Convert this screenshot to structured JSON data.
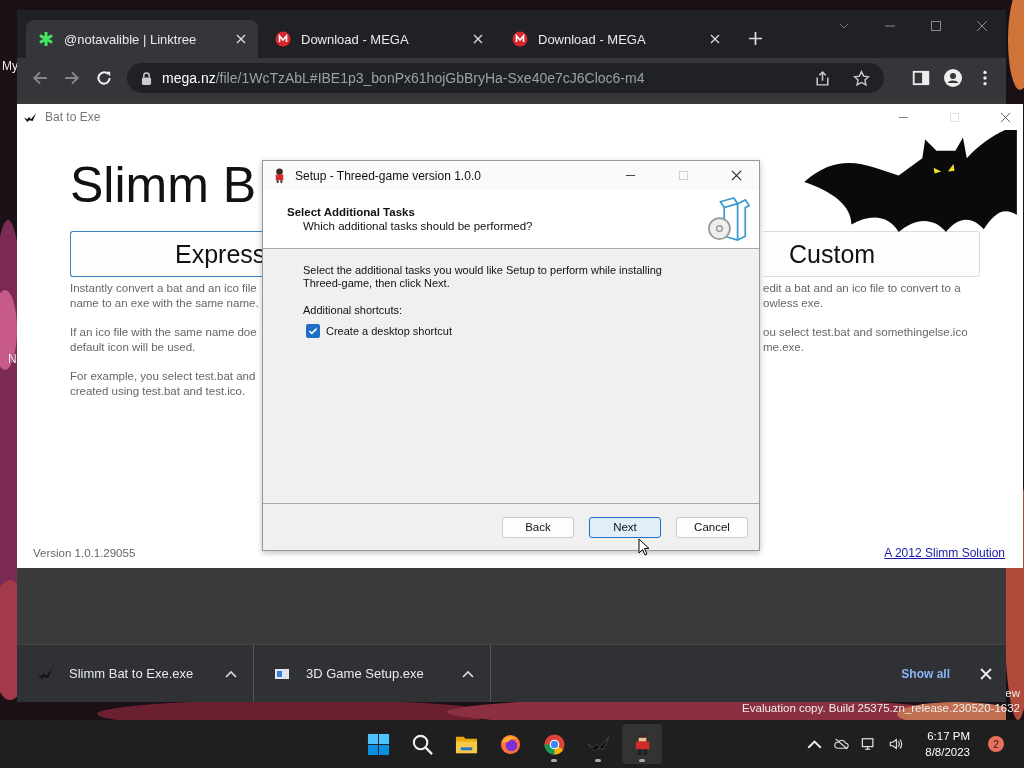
{
  "desktop": {
    "labels": [
      "My",
      "N"
    ],
    "watermark": [
      "ew",
      "Evaluation copy. Build 25375.zn_release.230520-1632"
    ]
  },
  "browser": {
    "tabs": [
      {
        "title": "@notavalible | Linktree",
        "kind": "linktree",
        "selected": true
      },
      {
        "title": "Download - MEGA",
        "kind": "mega",
        "selected": false
      },
      {
        "title": "Download - MEGA",
        "kind": "mega",
        "selected": false
      }
    ],
    "address": {
      "host": "mega.nz",
      "path": "/file/1WcTzAbL#IBE1p3_bonPx61hojGbBryHa-Sxe40e7cJ6Cloc6-m4"
    },
    "downloads": {
      "items": [
        {
          "name": "Slimm Bat to Exe.exe",
          "kind": "bat"
        },
        {
          "name": "3D Game Setup.exe",
          "kind": "setup"
        }
      ],
      "show_all": "Show all"
    }
  },
  "bat_app": {
    "title": "Bat to Exe",
    "heading": "Slimm B",
    "modes": [
      {
        "label": "Express",
        "paragraphs": [
          [
            "Instantly convert a bat and an ico file",
            "name to an exe with the same name."
          ],
          [
            "If an ico file with the same name doe",
            "default icon will be used."
          ],
          [
            "For example, you select test.bat and",
            "created using test.bat and test.ico."
          ]
        ]
      },
      {
        "label": "Custom",
        "paragraphs": [
          [
            "edit a bat and an ico file to convert to a",
            "owless exe."
          ],
          [
            "ou select test.bat and somethingelse.ico",
            "me.exe."
          ]
        ]
      }
    ],
    "version": "Version 1.0.1.29055",
    "link": "A 2012 Slimm Solution"
  },
  "setup": {
    "title": "Setup - Threed-game version 1.0.0",
    "heading": "Select Additional Tasks",
    "subheading": "Which additional tasks should be performed?",
    "intro": "Select the additional tasks you would like Setup to perform while installing Threed-game, then click Next.",
    "group_label": "Additional shortcuts:",
    "tasks": [
      {
        "label": "Create a desktop shortcut",
        "checked": true
      }
    ],
    "buttons": [
      {
        "label": "Back",
        "focused": false
      },
      {
        "label": "Next",
        "focused": true
      },
      {
        "label": "Cancel",
        "focused": false
      }
    ]
  },
  "taskbar": {
    "apps": [
      {
        "kind": "start",
        "running": false,
        "active": false
      },
      {
        "kind": "search",
        "running": false,
        "active": false
      },
      {
        "kind": "folder",
        "running": false,
        "active": false
      },
      {
        "kind": "firefox",
        "running": false,
        "active": false
      },
      {
        "kind": "chrome",
        "running": true,
        "active": false
      },
      {
        "kind": "bat",
        "running": true,
        "active": false
      },
      {
        "kind": "game",
        "running": true,
        "active": true
      }
    ],
    "time": "6:17 PM",
    "date": "8/8/2023",
    "notifications": "2"
  }
}
